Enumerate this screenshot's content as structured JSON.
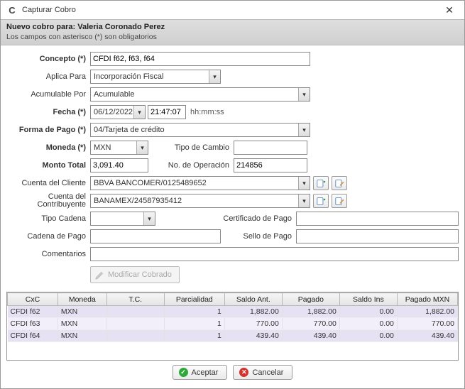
{
  "window": {
    "title": "Capturar Cobro"
  },
  "header": {
    "line1_prefix": "Nuevo cobro para: ",
    "customer": "Valeria Coronado Perez",
    "line2": "Los campos con asterisco (*) son obligatorios"
  },
  "labels": {
    "concepto": "Concepto (*)",
    "aplicaPara": "Aplica Para",
    "acumulablePor": "Acumulable Por",
    "fecha": "Fecha (*)",
    "hhmmss": "hh:mm:ss",
    "formaPago": "Forma de Pago (*)",
    "moneda": "Moneda (*)",
    "tipoCambio": "Tipo de Cambio",
    "montoTotal": "Monto Total",
    "noOperacion": "No. de Operación",
    "cuentaCliente": "Cuenta del Cliente",
    "cuentaContribuyente": "Cuenta del Contribuyente",
    "tipoCadena": "Tipo Cadena",
    "certificadoPago": "Certificado de Pago",
    "cadenaPago": "Cadena de Pago",
    "selloPago": "Sello de Pago",
    "comentarios": "Comentarios",
    "modificarCobrado": "Modificar Cobrado"
  },
  "values": {
    "concepto": "CFDI f62, f63, f64",
    "aplicaPara": "Incorporación Fiscal",
    "acumulablePor": "Acumulable",
    "fecha": "06/12/2022",
    "hora": "21:47:07",
    "formaPago": "04/Tarjeta de crédito",
    "moneda": "MXN",
    "tipoCambio": "",
    "montoTotal": "3,091.40",
    "noOperacion": "214856",
    "cuentaCliente": "BBVA BANCOMER/0125489652",
    "cuentaContribuyente": "BANAMEX/24587935412",
    "tipoCadena": "",
    "certificadoPago": "",
    "cadenaPago": "",
    "selloPago": "",
    "comentarios": ""
  },
  "buttons": {
    "aceptar": "Aceptar",
    "cancelar": "Cancelar"
  },
  "grid": {
    "headers": [
      "CxC",
      "Moneda",
      "T.C.",
      "Parcialidad",
      "Saldo Ant.",
      "Pagado",
      "Saldo Ins",
      "Pagado MXN"
    ],
    "rows": [
      {
        "cxc": "CFDI f62",
        "moneda": "MXN",
        "tc": "",
        "parcialidad": "1",
        "saldoAnt": "1,882.00",
        "pagado": "1,882.00",
        "saldoIns": "0.00",
        "pagadoMXN": "1,882.00"
      },
      {
        "cxc": "CFDI f63",
        "moneda": "MXN",
        "tc": "",
        "parcialidad": "1",
        "saldoAnt": "770.00",
        "pagado": "770.00",
        "saldoIns": "0.00",
        "pagadoMXN": "770.00"
      },
      {
        "cxc": "CFDI f64",
        "moneda": "MXN",
        "tc": "",
        "parcialidad": "1",
        "saldoAnt": "439.40",
        "pagado": "439.40",
        "saldoIns": "0.00",
        "pagadoMXN": "439.40"
      }
    ]
  }
}
